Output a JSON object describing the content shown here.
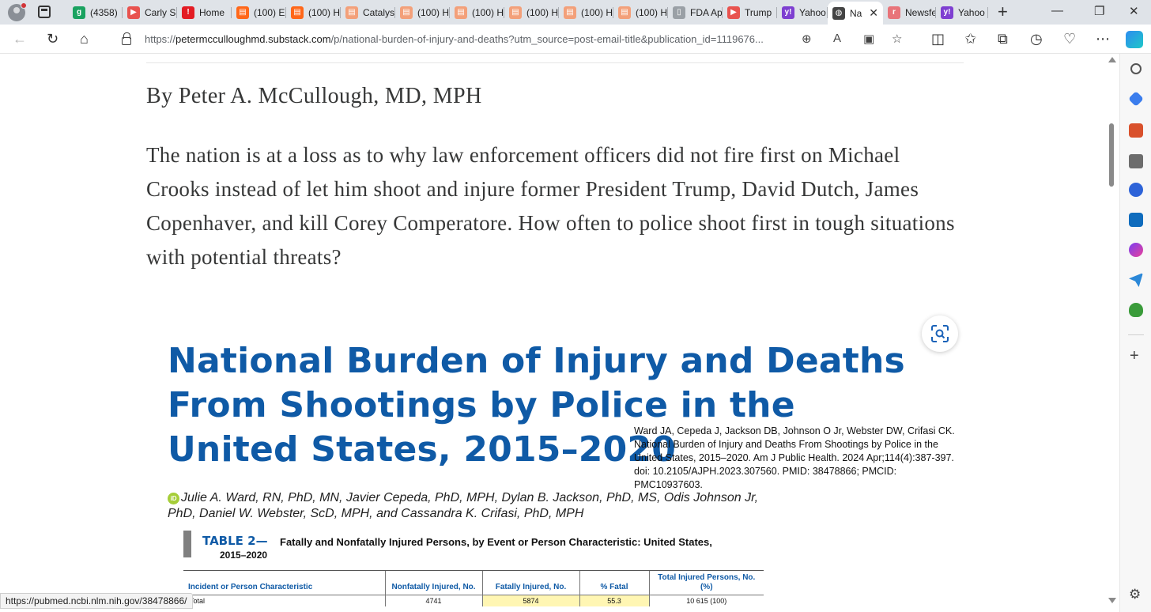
{
  "tabs": [
    {
      "label": "(4358)",
      "favicon_color": "#1aa260",
      "favicon_char": "g"
    },
    {
      "label": "Carly S",
      "favicon_color": "#e8534f",
      "favicon_char": "▶"
    },
    {
      "label": "Home",
      "favicon_color": "#e31b23",
      "favicon_char": "!"
    },
    {
      "label": "(100) E",
      "favicon_color": "#ff6719",
      "favicon_char": "▤"
    },
    {
      "label": "(100) H",
      "favicon_color": "#ff6719",
      "favicon_char": "▤"
    },
    {
      "label": "Catalys",
      "favicon_color": "#f3a07a",
      "favicon_char": "▤"
    },
    {
      "label": "(100) H",
      "favicon_color": "#f3a07a",
      "favicon_char": "▤"
    },
    {
      "label": "(100) H",
      "favicon_color": "#f3a07a",
      "favicon_char": "▤"
    },
    {
      "label": "(100) H",
      "favicon_color": "#f3a07a",
      "favicon_char": "▤"
    },
    {
      "label": "(100) H",
      "favicon_color": "#f3a07a",
      "favicon_char": "▤"
    },
    {
      "label": "(100) H",
      "favicon_color": "#f3a07a",
      "favicon_char": "▤"
    },
    {
      "label": "FDA Ap",
      "favicon_color": "#9aa0a6",
      "favicon_char": "▯"
    },
    {
      "label": "Trump",
      "favicon_color": "#e8534f",
      "favicon_char": "▶"
    },
    {
      "label": "Yahoo",
      "favicon_color": "#7e3fd1",
      "favicon_char": "y!"
    },
    {
      "label": "Na",
      "favicon_color": "#444444",
      "favicon_char": "◍",
      "active": true
    },
    {
      "label": "Newsfe",
      "favicon_color": "#e8747a",
      "favicon_char": "r"
    },
    {
      "label": "Yahoo",
      "favicon_color": "#7e3fd1",
      "favicon_char": "y!"
    }
  ],
  "address": {
    "prefix": "https://",
    "host": "petermcculloughmd.substack.com",
    "path": "/p/national-burden-of-injury-and-deaths?utm_source=post-email-title&publication_id=1119676..."
  },
  "article": {
    "byline": "By Peter A. McCullough, MD, MPH",
    "lead": "The nation is at a loss as to why law enforcement officers did not fire first on Michael Crooks instead of let him shoot and injure former President Trump, David Dutch, James Copenhaver, and kill Corey Comperatore. How often to police shoot first in tough situations with potential threats?"
  },
  "figure": {
    "title_line1": "National Burden of Injury and Deaths",
    "title_line2": "From Shootings by Police in the",
    "title_line3": "United States, 2015–2020",
    "citation": "Ward JA, Cepeda J, Jackson DB, Johnson O Jr, Webster DW, Crifasi CK. National Burden of Injury and Deaths From Shootings by Police in the United States, 2015–2020. Am J Public Health. 2024 Apr;114(4):387-397. doi: 10.2105/AJPH.2023.307560. PMID: 38478866; PMCID: PMC10937603.",
    "orcid_label": "iD",
    "authors": "Julie A. Ward, RN, PhD, MN, Javier Cepeda, PhD, MPH, Dylan B. Jackson, PhD, MS, Odis Johnson Jr, PhD, Daniel W. Webster, ScD, MPH, and Cassandra K. Crifasi, PhD, MPH",
    "table_label": "TABLE 2—",
    "table_caption": "Fatally and Nonfatally Injured Persons, by Event or Person Characteristic: United States,",
    "table_caption_years": "2015–2020",
    "columns": [
      "Incident or Person Characteristic",
      "Nonfatally Injured, No.",
      "Fatally Injured, No.",
      "% Fatal",
      "Total Injured Persons, No. (%)"
    ],
    "rows": [
      [
        "Total",
        "4741",
        "5874",
        "55.3",
        "10 615 (100)"
      ]
    ]
  },
  "status_url": "https://pubmed.ncbi.nlm.nih.gov/38478866/"
}
